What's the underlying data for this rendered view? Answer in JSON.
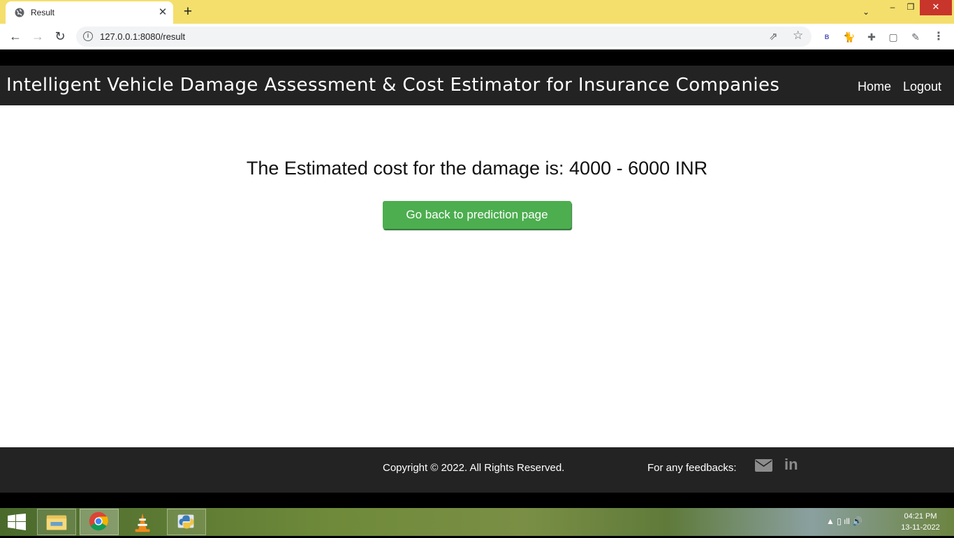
{
  "browser": {
    "tab_title": "Result",
    "tab_close": "✕",
    "new_tab": "+",
    "tab_search": "⌄",
    "minimize": "–",
    "maximize": "❐",
    "close": "✕",
    "back": "←",
    "forward": "→",
    "reload": "↻",
    "url": "127.0.0.1:8080/result",
    "info": "i",
    "share": "⇗",
    "bookmark": "☆",
    "extensions": {
      "b": "B",
      "cat": "🐈",
      "puzzle": "✚",
      "panel": "▢",
      "avatar": "✎",
      "menu": "⋮"
    }
  },
  "header": {
    "title": "Intelligent Vehicle Damage Assessment & Cost Estimator for Insurance Companies",
    "nav": {
      "home": "Home",
      "logout": "Logout"
    }
  },
  "main": {
    "result_text": "The Estimated cost for the damage is: 4000 - 6000 INR",
    "back_button": "Go back to prediction page"
  },
  "footer": {
    "copyright": "Copyright © 2022. All Rights Reserved.",
    "feedback_label": "For any feedbacks:",
    "linkedin": "in"
  },
  "taskbar": {
    "tray": "▲  ▯  ıll  🔊",
    "time": "04:21 PM",
    "date": "13-11-2022"
  },
  "colors": {
    "tabstrip": "#f4df6c",
    "header_bg": "#232323",
    "button_green": "#4cae4f",
    "icon_gray": "#8c8c8c"
  }
}
